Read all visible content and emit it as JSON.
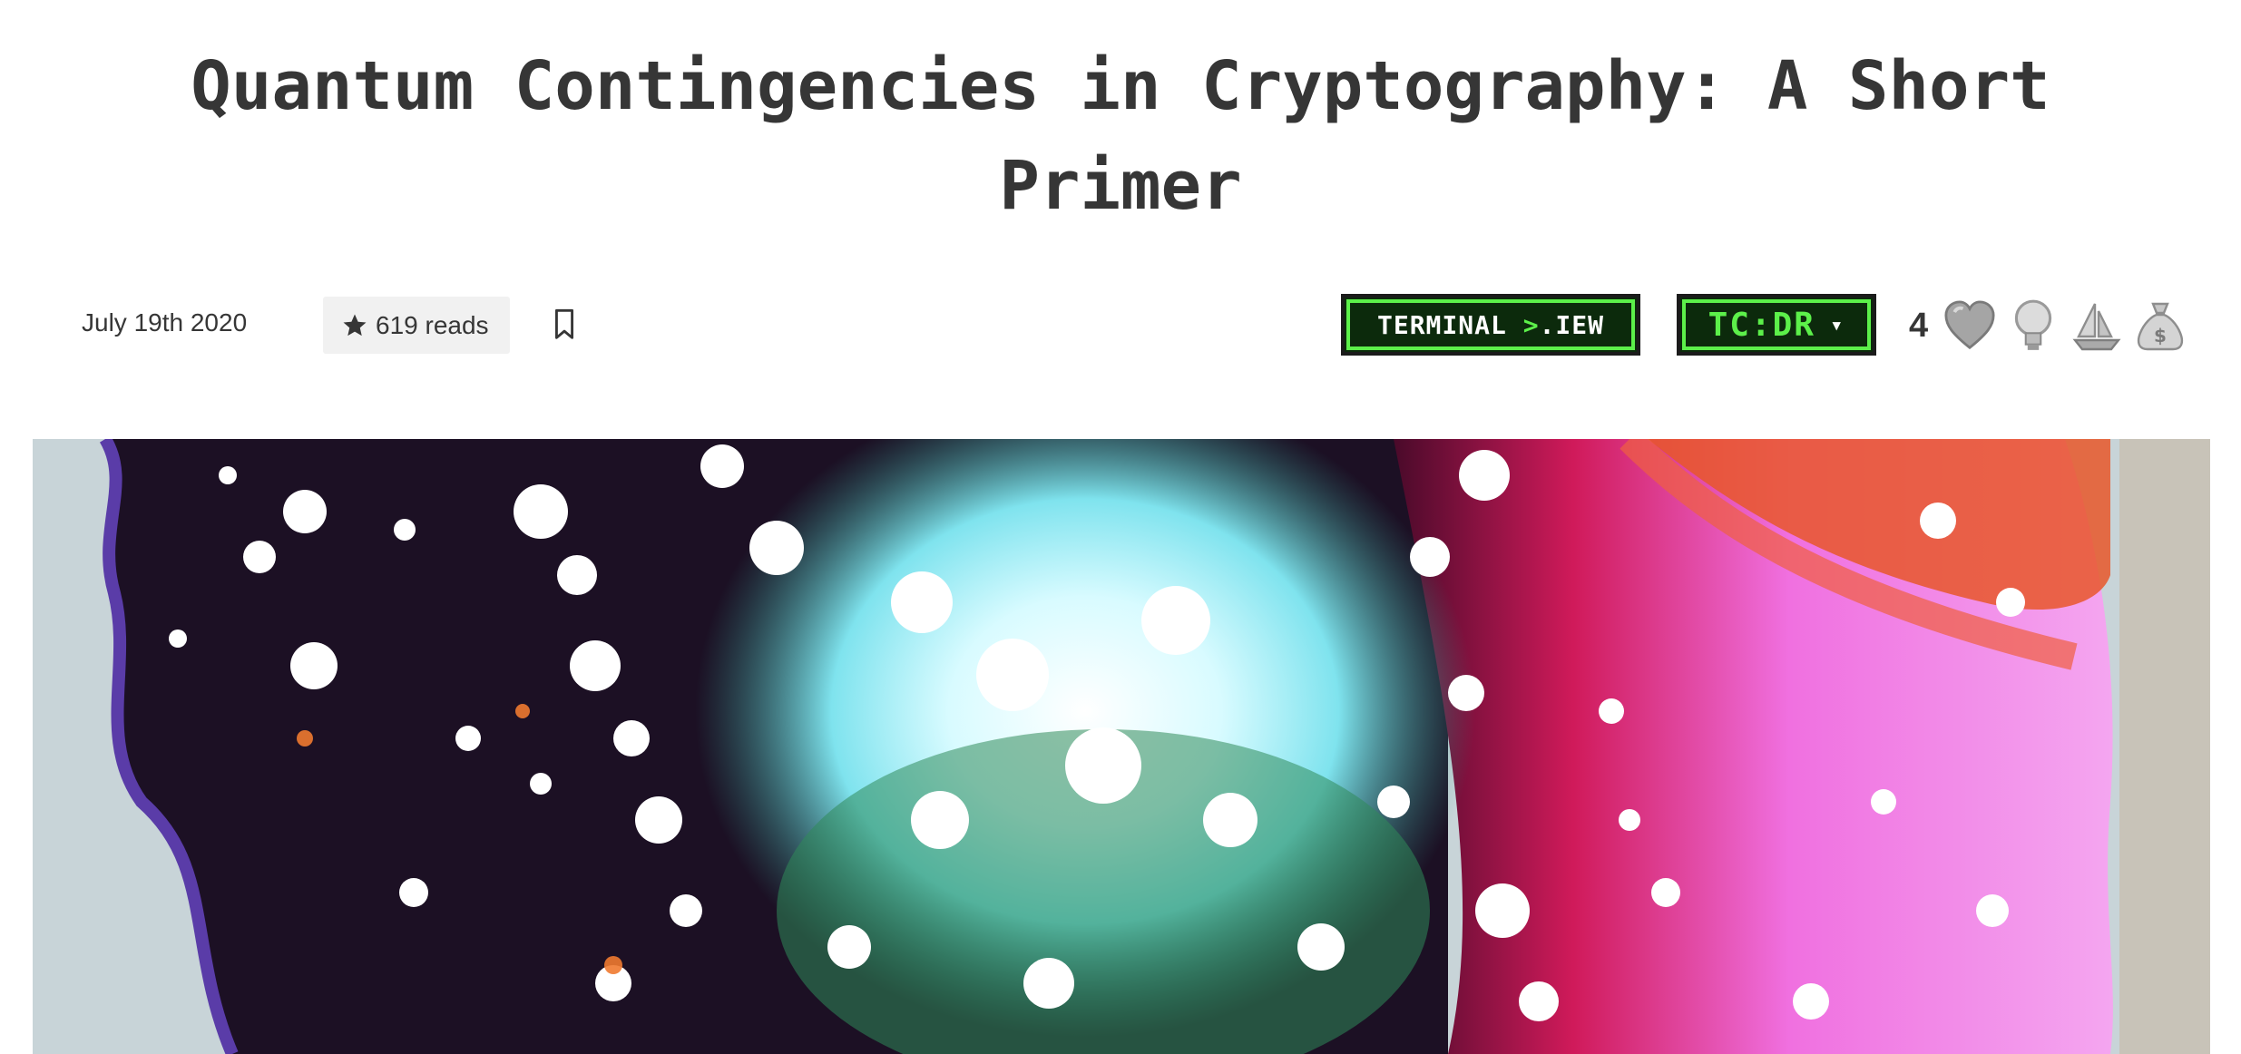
{
  "article": {
    "title": "Quantum Contingencies in Cryptography: A Short Primer",
    "date": "July 19th 2020",
    "reads": "619 reads"
  },
  "badges": {
    "terminal": {
      "prefix": "TERMINAL",
      "arrow": ">",
      "suffix": ".IEW"
    },
    "tcdr": {
      "text": "TC:DR",
      "caret": "▾"
    }
  },
  "reactions": {
    "count": "4",
    "icons": [
      "heart-icon",
      "lightbulb-icon",
      "sailboat-icon",
      "money-bag-icon"
    ]
  },
  "hero": {
    "icon": "abstract-cosmic-art-image"
  },
  "colors": {
    "title": "#363636",
    "badge_bg": "#0c2a0c",
    "badge_accent": "#5cf04a",
    "reads_bg": "#f1f1f1"
  }
}
